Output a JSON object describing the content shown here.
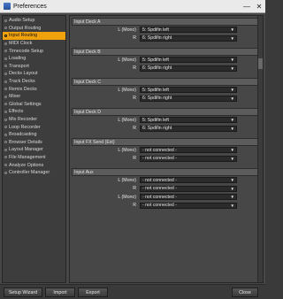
{
  "window": {
    "title": "Preferences"
  },
  "sidebar": {
    "items": [
      {
        "label": "Audio Setup",
        "active": false
      },
      {
        "label": "Output Routing",
        "active": false
      },
      {
        "label": "Input Routing",
        "active": true
      },
      {
        "label": "MIDI Clock",
        "active": false
      },
      {
        "label": "Timecode Setup",
        "active": false
      },
      {
        "label": "Loading",
        "active": false
      },
      {
        "label": "Transport",
        "active": false
      },
      {
        "label": "Decks Layout",
        "active": false
      },
      {
        "label": "Track Decks",
        "active": false
      },
      {
        "label": "Remix Decks",
        "active": false
      },
      {
        "label": "Mixer",
        "active": false
      },
      {
        "label": "Global Settings",
        "active": false
      },
      {
        "label": "Effects",
        "active": false
      },
      {
        "label": "Mix Recorder",
        "active": false
      },
      {
        "label": "Loop Recorder",
        "active": false
      },
      {
        "label": "Broadcasting",
        "active": false
      },
      {
        "label": "Browser Details",
        "active": false
      },
      {
        "label": "Layout Manager",
        "active": false
      },
      {
        "label": "File Management",
        "active": false
      },
      {
        "label": "Analyze Options",
        "active": false
      },
      {
        "label": "Controller Manager",
        "active": false
      }
    ]
  },
  "sections": [
    {
      "title": "Input Deck A",
      "rows": [
        {
          "label": "L (Mono)",
          "value": "5: Spdifin left"
        },
        {
          "label": "R",
          "value": "6: Spdifin right"
        }
      ]
    },
    {
      "title": "Input Deck B",
      "rows": [
        {
          "label": "L (Mono)",
          "value": "5: Spdifin left"
        },
        {
          "label": "R",
          "value": "6: Spdifin right"
        }
      ]
    },
    {
      "title": "Input Deck C",
      "rows": [
        {
          "label": "L (Mono)",
          "value": "5: Spdifin left"
        },
        {
          "label": "R",
          "value": "6: Spdifin right"
        }
      ]
    },
    {
      "title": "Input Deck D",
      "rows": [
        {
          "label": "L (Mono)",
          "value": "5: Spdifin left"
        },
        {
          "label": "R",
          "value": "6: Spdifin right"
        }
      ]
    },
    {
      "title": "Input FX Send (Ext)",
      "rows": [
        {
          "label": "L (Mono)",
          "value": "- not connected -"
        },
        {
          "label": "R",
          "value": "- not connected -"
        }
      ]
    },
    {
      "title": "Input Aux",
      "rows": [
        {
          "label": "L (Mono)",
          "value": "- not connected -"
        },
        {
          "label": "R",
          "value": "- not connected -"
        },
        {
          "label": "L (Mono)",
          "value": "- not connected -"
        },
        {
          "label": "R",
          "value": "- not connected -"
        }
      ]
    }
  ],
  "footer": {
    "setup_wizard": "Setup Wizard",
    "import": "Import",
    "export": "Export",
    "close": "Close"
  },
  "icons": {
    "app": "app-icon",
    "minimize": "minimize-icon",
    "close": "close-icon",
    "dropdown": "chevron-down-icon"
  },
  "colors": {
    "accent": "#f0a20c",
    "panel": "#474747",
    "select_bg": "#2b2b2b"
  }
}
